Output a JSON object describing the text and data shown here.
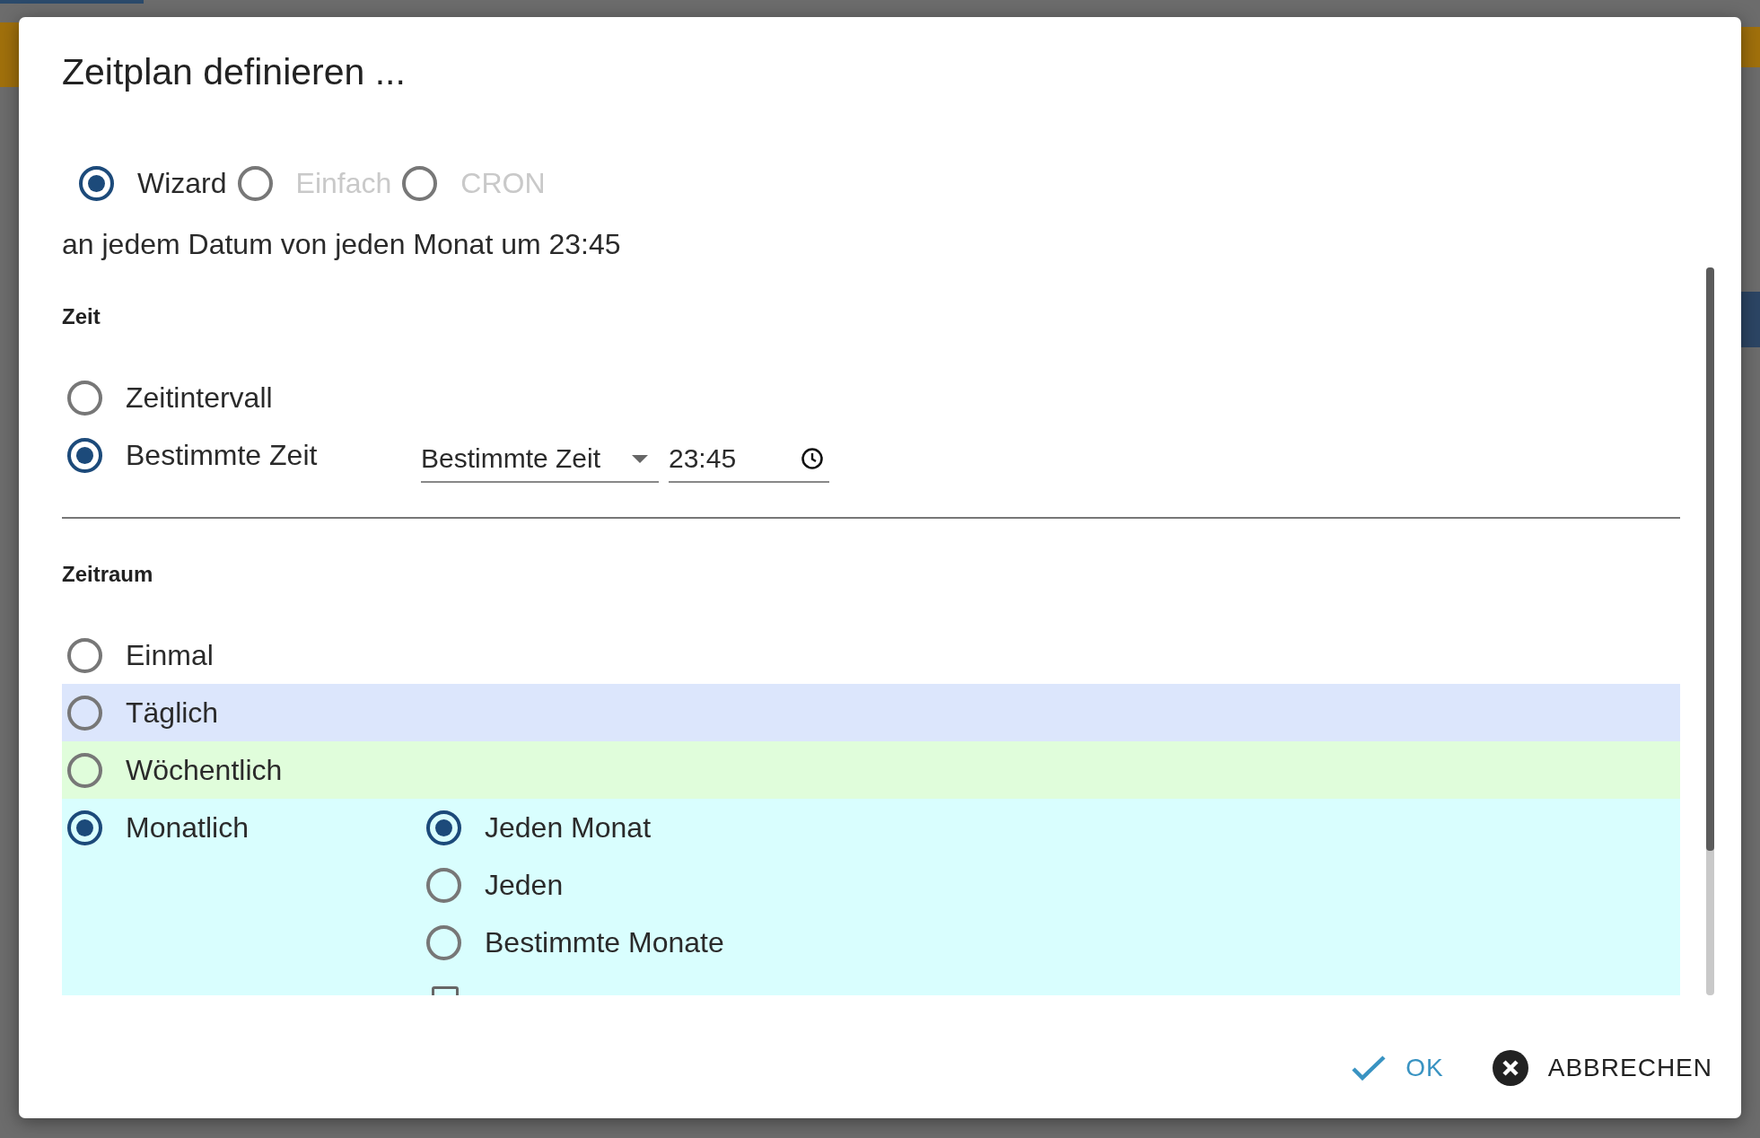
{
  "dialog": {
    "title": "Zeitplan definieren ...",
    "modes": [
      {
        "label": "Wizard",
        "selected": true,
        "disabled": false
      },
      {
        "label": "Einfach",
        "selected": false,
        "disabled": true
      },
      {
        "label": "CRON",
        "selected": false,
        "disabled": true
      }
    ],
    "summary": "an jedem Datum von jeden Monat um 23:45",
    "time_section": {
      "heading": "Zeit",
      "options": [
        {
          "label": "Zeitintervall",
          "selected": false
        },
        {
          "label": "Bestimmte Zeit",
          "selected": true
        }
      ],
      "time_type_select": {
        "value": "Bestimmte Zeit"
      },
      "time_field": {
        "value": "23:45"
      }
    },
    "period_section": {
      "heading": "Zeitraum",
      "options": [
        {
          "label": "Einmal",
          "selected": false
        },
        {
          "label": "Täglich",
          "selected": false,
          "color": "#dce6fc"
        },
        {
          "label": "Wöchentlich",
          "selected": false,
          "color": "#e0fddb"
        },
        {
          "label": "Monatlich",
          "selected": true,
          "color": "#d9fefe",
          "sub_options": [
            {
              "label": "Jeden Monat",
              "selected": true
            },
            {
              "label": "Jeden",
              "selected": false
            },
            {
              "label": "Bestimmte Monate",
              "selected": false
            }
          ],
          "extra_checkbox": {
            "checked": false
          }
        }
      ]
    },
    "buttons": [
      {
        "kind": "confirm",
        "label": "OK"
      },
      {
        "kind": "cancel",
        "label": "ABBRECHEN"
      }
    ]
  }
}
